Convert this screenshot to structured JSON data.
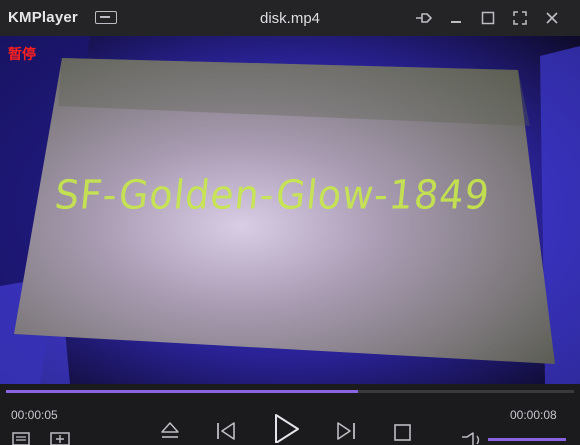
{
  "app": {
    "brand": "KMPlayer",
    "title": "disk.mp4"
  },
  "overlay": {
    "status": "暂停"
  },
  "video": {
    "handwriting": "SF-Golden-Glow-1849"
  },
  "playback": {
    "current_time": "00:00:05",
    "total_time": "00:00:08",
    "progress_fraction": 0.62,
    "volume_fraction": 1.0
  },
  "colors": {
    "accent": "#8a63e0",
    "status_text": "#ff2020",
    "titlebar": "#242426",
    "handwriting": "#c8e84a"
  },
  "icons": {
    "menu": "menu-icon",
    "pin": "pin-icon",
    "minimize": "minimize-icon",
    "maximize": "maximize-icon",
    "fullscreen": "fullscreen-icon",
    "close": "close-icon",
    "playlist": "playlist-icon",
    "add": "add-icon",
    "eject": "eject-icon",
    "previous": "previous-icon",
    "play": "play-icon",
    "next": "next-icon",
    "stop": "stop-icon",
    "volume": "volume-icon"
  }
}
